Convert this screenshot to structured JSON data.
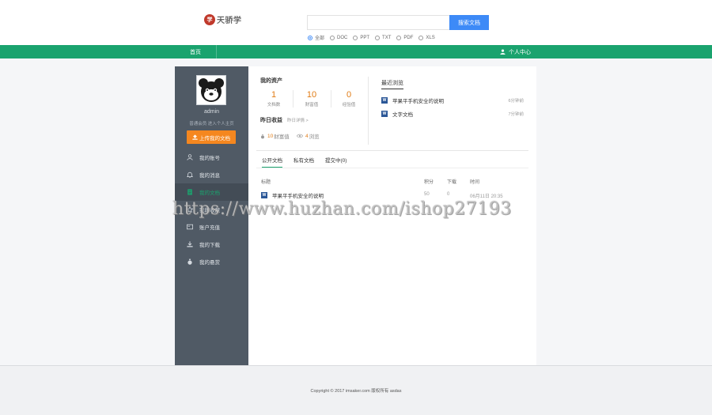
{
  "header": {
    "logo_text": "天骄学",
    "search": {
      "placeholder": "",
      "button_label": "搜索文档"
    },
    "filters": [
      {
        "label": "全部",
        "selected": true
      },
      {
        "label": "DOC",
        "selected": false
      },
      {
        "label": "PPT",
        "selected": false
      },
      {
        "label": "TXT",
        "selected": false
      },
      {
        "label": "PDF",
        "selected": false
      },
      {
        "label": "XLS",
        "selected": false
      }
    ]
  },
  "nav": {
    "home": "首页",
    "user_center": "个人中心"
  },
  "sidebar": {
    "username": "admin",
    "subtitle": "普通会员  进入个人主页",
    "upload_label": "上传我的文档",
    "menu": [
      {
        "label": "我的账号",
        "icon": "user-icon",
        "active": false
      },
      {
        "label": "我的消息",
        "icon": "bell-icon",
        "active": false
      },
      {
        "label": "我的文档",
        "icon": "document-icon",
        "active": true
      },
      {
        "label": "我的收藏",
        "icon": "star-icon",
        "active": false
      },
      {
        "label": "账户充值",
        "icon": "wallet-icon",
        "active": false
      },
      {
        "label": "我的下载",
        "icon": "download-icon",
        "active": false
      },
      {
        "label": "我的悬赏",
        "icon": "money-bag-icon",
        "active": false
      }
    ]
  },
  "assets": {
    "title": "我的资产",
    "stats": [
      {
        "value": "1",
        "label": "文档数"
      },
      {
        "value": "10",
        "label": "财富值"
      },
      {
        "value": "0",
        "label": "经验值"
      }
    ]
  },
  "yesterday": {
    "title": "昨日收益",
    "link": "昨日详情 >",
    "wealth_value": "10",
    "wealth_label": "财富值",
    "views_value": "4",
    "views_label": "浏览"
  },
  "recent": {
    "title": "最近浏览",
    "items": [
      {
        "title": "苹果平手机安全的说明",
        "time": "6分钟前"
      },
      {
        "title": "文字文档",
        "time": "7分钟前"
      }
    ]
  },
  "tabs": [
    {
      "label": "公开文档",
      "active": true
    },
    {
      "label": "私有文档",
      "active": false
    },
    {
      "label": "提交中(0)",
      "active": false
    }
  ],
  "table": {
    "headers": [
      "标题",
      "积分",
      "下载",
      "时间"
    ],
    "rows": [
      {
        "title": "苹果平手机安全的说明",
        "points": "50",
        "downloads": "0",
        "time": "06月11日 20:35"
      }
    ]
  },
  "footer": {
    "text": "Copyright © 2017 imsaker.com 版权所有 asdas"
  },
  "watermark": "https://www.huzhan.com/ishop27193",
  "colors": {
    "nav_green": "#1aa36e",
    "search_blue": "#3d8af7",
    "upload_orange": "#f5871f",
    "sidebar_bg": "#505a65",
    "stat_orange": "#e07b14"
  }
}
